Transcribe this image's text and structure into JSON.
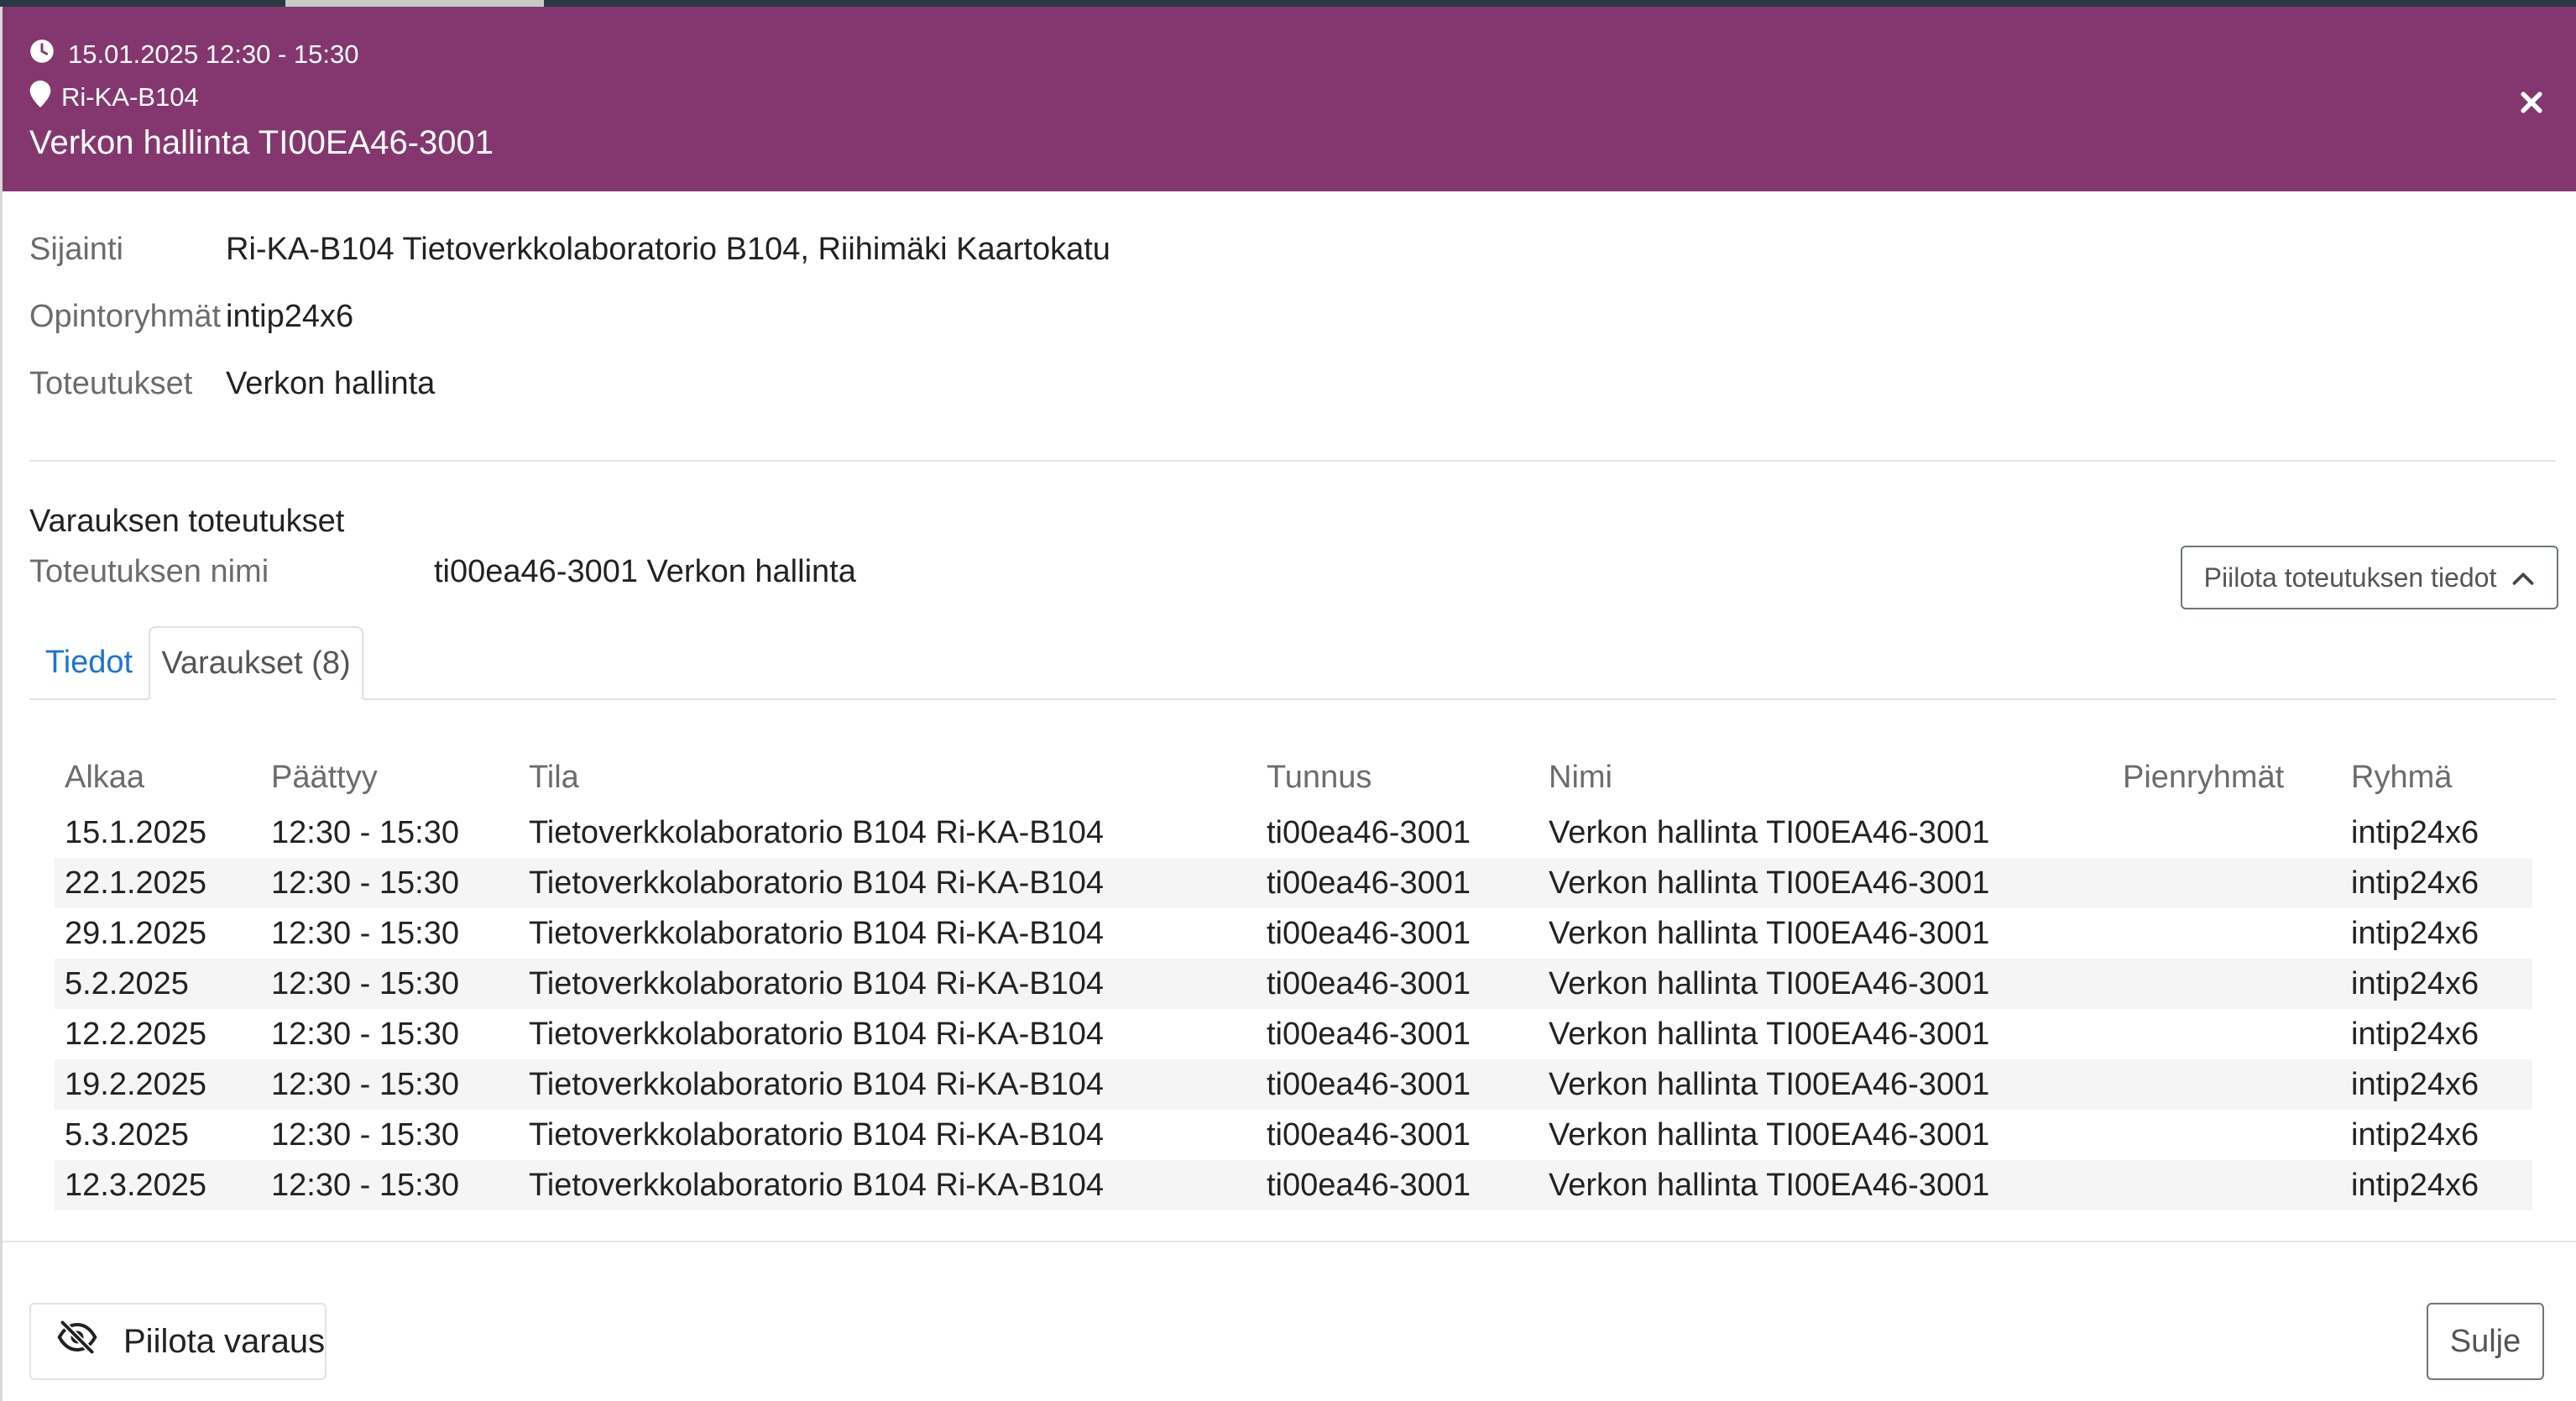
{
  "header": {
    "datetime": "15.01.2025 12:30 - 15:30",
    "location_code": "Ri-KA-B104",
    "title": "Verkon hallinta TI00EA46-3001"
  },
  "details": {
    "location_label": "Sijainti",
    "location_value": "Ri-KA-B104 Tietoverkkolaboratorio B104, Riihimäki Kaartokatu",
    "groups_label": "Opintoryhmät",
    "groups_value": "intip24x6",
    "implementations_label": "Toteutukset",
    "implementations_value": "Verkon hallinta"
  },
  "reservation_implementations": {
    "section_title": "Varauksen toteutukset",
    "name_label": "Toteutuksen nimi",
    "name_value": "ti00ea46-3001 Verkon hallinta",
    "hide_details_label": "Piilota toteutuksen tiedot"
  },
  "tabs": [
    {
      "label": "Tiedot",
      "active": false
    },
    {
      "label": "Varaukset (8)",
      "active": true
    }
  ],
  "table": {
    "headers": [
      "Alkaa",
      "Päättyy",
      "Tila",
      "Tunnus",
      "Nimi",
      "Pienryhmät",
      "Ryhmä"
    ],
    "rows": [
      [
        "15.1.2025",
        "12:30 - 15:30",
        "Tietoverkkolaboratorio B104 Ri-KA-B104",
        "ti00ea46-3001",
        "Verkon hallinta TI00EA46-3001",
        "",
        "intip24x6"
      ],
      [
        "22.1.2025",
        "12:30 - 15:30",
        "Tietoverkkolaboratorio B104 Ri-KA-B104",
        "ti00ea46-3001",
        "Verkon hallinta TI00EA46-3001",
        "",
        "intip24x6"
      ],
      [
        "29.1.2025",
        "12:30 - 15:30",
        "Tietoverkkolaboratorio B104 Ri-KA-B104",
        "ti00ea46-3001",
        "Verkon hallinta TI00EA46-3001",
        "",
        "intip24x6"
      ],
      [
        "5.2.2025",
        "12:30 - 15:30",
        "Tietoverkkolaboratorio B104 Ri-KA-B104",
        "ti00ea46-3001",
        "Verkon hallinta TI00EA46-3001",
        "",
        "intip24x6"
      ],
      [
        "12.2.2025",
        "12:30 - 15:30",
        "Tietoverkkolaboratorio B104 Ri-KA-B104",
        "ti00ea46-3001",
        "Verkon hallinta TI00EA46-3001",
        "",
        "intip24x6"
      ],
      [
        "19.2.2025",
        "12:30 - 15:30",
        "Tietoverkkolaboratorio B104 Ri-KA-B104",
        "ti00ea46-3001",
        "Verkon hallinta TI00EA46-3001",
        "",
        "intip24x6"
      ],
      [
        "5.3.2025",
        "12:30 - 15:30",
        "Tietoverkkolaboratorio B104 Ri-KA-B104",
        "ti00ea46-3001",
        "Verkon hallinta TI00EA46-3001",
        "",
        "intip24x6"
      ],
      [
        "12.3.2025",
        "12:30 - 15:30",
        "Tietoverkkolaboratorio B104 Ri-KA-B104",
        "ti00ea46-3001",
        "Verkon hallinta TI00EA46-3001",
        "",
        "intip24x6"
      ]
    ]
  },
  "footer": {
    "hide_reservation_label": "Piilota varaus",
    "close_label": "Sulje"
  },
  "icons": {
    "time": "clock-icon",
    "location": "map-pin-icon",
    "close": "close-icon",
    "collapse": "chevron-up-icon",
    "hide": "eye-slash-icon"
  },
  "colors": {
    "header_bg": "#84376f",
    "tab_active_link": "#1a73d9"
  }
}
